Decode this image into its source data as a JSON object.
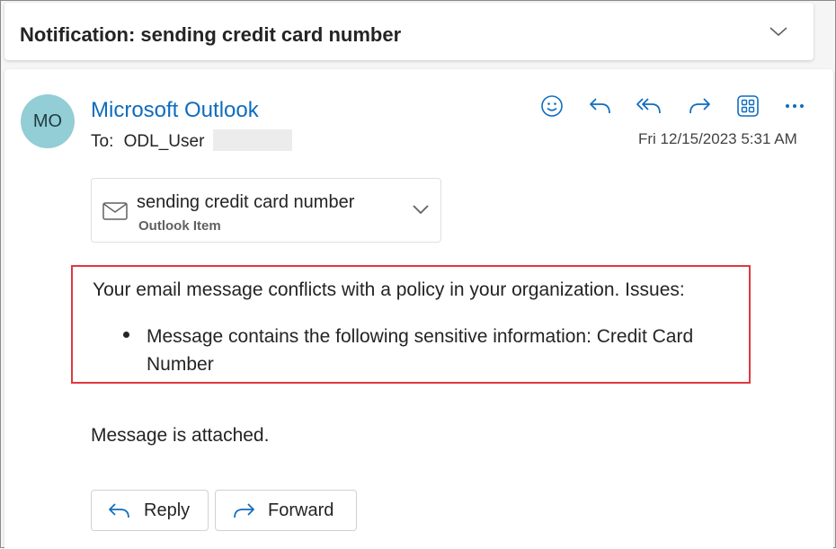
{
  "subject": {
    "title": "Notification: sending credit card number"
  },
  "message": {
    "avatar_initials": "MO",
    "sender": "Microsoft Outlook",
    "to_label": "To:",
    "to_name": "ODL_User",
    "date": "Fri 12/15/2023 5:31 AM",
    "actions": [
      "smile-icon",
      "reply-icon",
      "reply-all-icon",
      "forward-icon",
      "apps-icon",
      "more-icon"
    ]
  },
  "attachment": {
    "name": "sending credit card number",
    "type": "Outlook Item",
    "icon": "envelope-icon"
  },
  "body": {
    "policy_line": "Your email message conflicts with a policy in your organization. Issues:",
    "policy_bullet": "Message contains the following sensitive information: Credit Card Number",
    "attached_note": "Message is attached."
  },
  "buttons": {
    "reply_label": "Reply",
    "forward_label": "Forward"
  },
  "colors": {
    "accent": "#0f6cbd",
    "avatar_bg": "#93cdd5",
    "highlight_border": "#e0393e"
  }
}
